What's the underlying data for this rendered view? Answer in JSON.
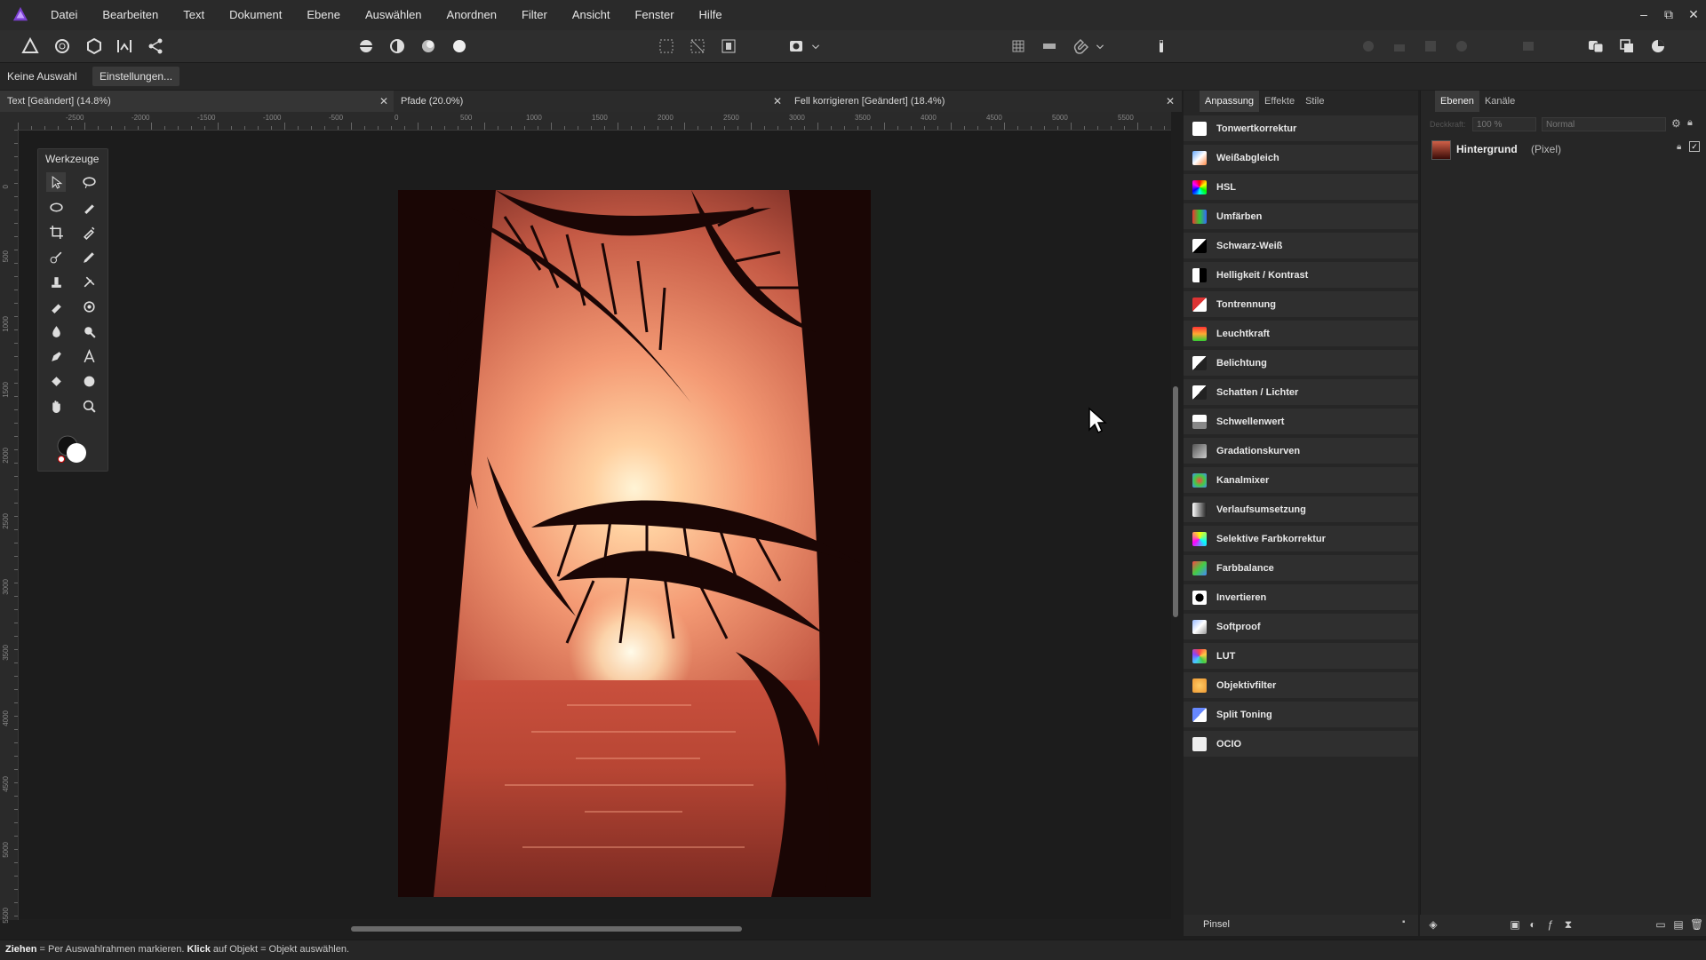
{
  "menu": [
    "Datei",
    "Bearbeiten",
    "Text",
    "Dokument",
    "Ebene",
    "Auswählen",
    "Anordnen",
    "Filter",
    "Ansicht",
    "Fenster",
    "Hilfe"
  ],
  "window_controls": [
    "–",
    "⧉",
    "✕"
  ],
  "context": {
    "selection_label": "Keine Auswahl",
    "settings_button": "Einstellungen..."
  },
  "doc_tabs": [
    {
      "label": "Text [Geändert] (14.8%)"
    },
    {
      "label": "Pfade (20.0%)"
    },
    {
      "label": "Fell korrigieren [Geändert] (18.4%)"
    }
  ],
  "ruler": {
    "top": [
      "-2500",
      "-2000",
      "-1500",
      "-1000",
      "-500",
      "0",
      "500",
      "1000",
      "1500",
      "2000",
      "2500",
      "3000",
      "3500",
      "4000",
      "4500",
      "5000",
      "5500"
    ],
    "left": [
      "0",
      "500",
      "1000",
      "1500",
      "2000",
      "2500",
      "3000",
      "3500",
      "4000",
      "4500",
      "5000",
      "5500"
    ]
  },
  "tools": {
    "title": "Werkzeuge"
  },
  "adjust_panel": {
    "tabs": [
      "Anpassung",
      "Effekte",
      "Stile"
    ],
    "items": [
      {
        "label": "Tonwertkorrektur",
        "icon": "levels-icon"
      },
      {
        "label": "Weißabgleich",
        "icon": "white-balance-icon"
      },
      {
        "label": "HSL",
        "icon": "hsl-icon"
      },
      {
        "label": "Umfärben",
        "icon": "recolor-icon"
      },
      {
        "label": "Schwarz-Weiß",
        "icon": "black-white-icon"
      },
      {
        "label": "Helligkeit / Kontrast",
        "icon": "brightness-contrast-icon"
      },
      {
        "label": "Tontrennung",
        "icon": "posterize-icon"
      },
      {
        "label": "Leuchtkraft",
        "icon": "vibrance-icon"
      },
      {
        "label": "Belichtung",
        "icon": "exposure-icon"
      },
      {
        "label": "Schatten / Lichter",
        "icon": "shadows-highlights-icon"
      },
      {
        "label": "Schwellenwert",
        "icon": "threshold-icon"
      },
      {
        "label": "Gradationskurven",
        "icon": "curves-icon"
      },
      {
        "label": "Kanalmixer",
        "icon": "channel-mixer-icon"
      },
      {
        "label": "Verlaufsumsetzung",
        "icon": "gradient-map-icon"
      },
      {
        "label": "Selektive Farbkorrektur",
        "icon": "selective-color-icon"
      },
      {
        "label": "Farbbalance",
        "icon": "color-balance-icon"
      },
      {
        "label": "Invertieren",
        "icon": "invert-icon"
      },
      {
        "label": "Softproof",
        "icon": "soft-proof-icon"
      },
      {
        "label": "LUT",
        "icon": "lut-icon"
      },
      {
        "label": "Objektivfilter",
        "icon": "lens-filter-icon"
      },
      {
        "label": "Split Toning",
        "icon": "split-toning-icon"
      },
      {
        "label": "OCIO",
        "icon": "ocio-icon"
      }
    ],
    "footer_label": "Pinsel"
  },
  "layers_panel": {
    "tabs": [
      "Ebenen",
      "Kanäle"
    ],
    "opacity_label": "Deckkraft:",
    "opacity": "100 %",
    "blend_mode": "Normal",
    "layer": {
      "name": "Hintergrund",
      "type": "(Pixel)"
    }
  },
  "status": {
    "bold1": "Ziehen",
    "text1": " = Per Auswahlrahmen markieren. ",
    "bold2": "Klick",
    "text2": " auf Objekt = Objekt auswählen."
  }
}
